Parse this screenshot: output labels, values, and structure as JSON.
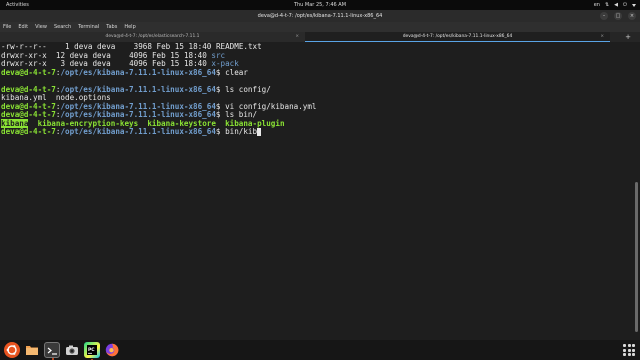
{
  "topbar": {
    "activities": "Activities",
    "clock": "Thu Mar 25,  7:46 AM",
    "lang": "en"
  },
  "window": {
    "title": "deva@d-4-t-7: /opt/es/kibana-7.11.1-linux-x86_64"
  },
  "menu": [
    "File",
    "Edit",
    "View",
    "Search",
    "Terminal",
    "Tabs",
    "Help"
  ],
  "tabs": [
    {
      "label": "deva@d-4-t-7: /opt/es/elasticsearch-7.11.1",
      "active": false
    },
    {
      "label": "deva@d-4-t-7: /opt/es/kibana-7.11.1-linux-x86_64",
      "active": true
    }
  ],
  "terminal": {
    "user": "deva@d-4-t-7",
    "path": "/opt/es/kibana-7.11.1-linux-x86_64",
    "lines": [
      {
        "perm": "-rw-r--r--",
        "links": "1",
        "owner": "deva",
        "group": "deva",
        "size": "3968",
        "date": "Feb 15 18:40",
        "name": "README.txt"
      },
      {
        "perm": "drwxr-xr-x",
        "links": "12",
        "owner": "deva",
        "group": "deva",
        "size": "4096",
        "date": "Feb 15 18:40",
        "name": "src"
      },
      {
        "perm": "drwxr-xr-x",
        "links": "3",
        "owner": "deva",
        "group": "deva",
        "size": "4096",
        "date": "Feb 15 18:40",
        "name": "x-pack"
      }
    ],
    "cmd1": "clear",
    "cmd2": "ls config/",
    "out2": "kibana.yml  node.options",
    "cmd3": "vi config/kibana.yml",
    "cmd4": "ls bin/",
    "bin_files": [
      "kibana",
      "kibana-encryption-keys",
      "kibana-keystore",
      "kibana-plugin"
    ],
    "cmd5": "bin/kib",
    "prompt_sep": ":",
    "prompt_end": "$ "
  },
  "colors": {
    "accent": "#e95420",
    "prompt_user": "#8ae234",
    "prompt_path": "#729fcf"
  },
  "dock": [
    "ubuntu-logo-icon",
    "files-icon",
    "terminal-icon",
    "screenshot-icon",
    "pycharm-icon",
    "firefox-icon",
    "show-apps-icon"
  ]
}
